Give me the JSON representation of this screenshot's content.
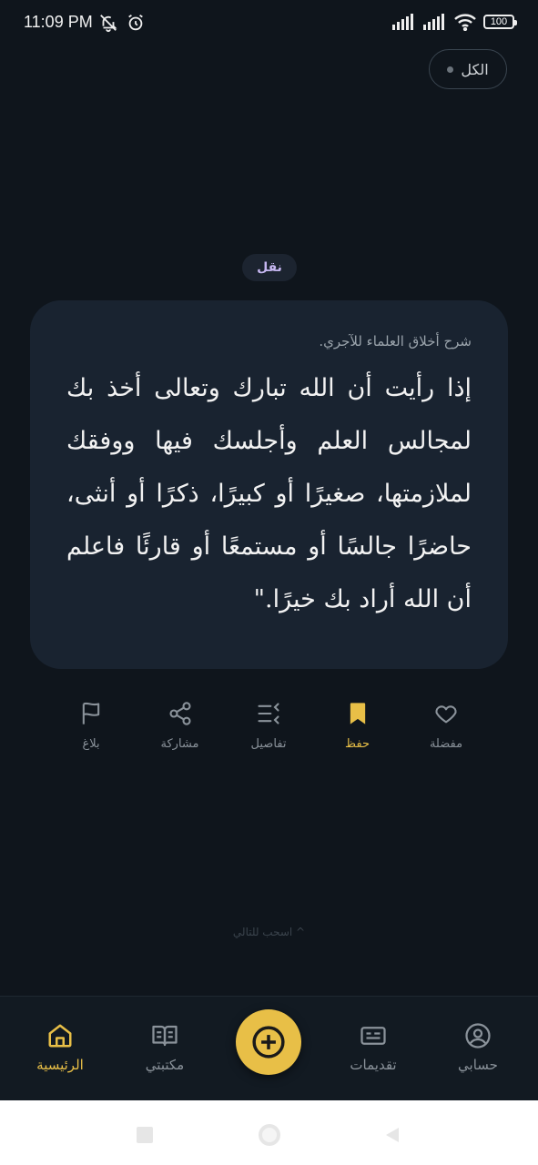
{
  "status": {
    "time": "11:09 PM",
    "battery": "100"
  },
  "filter": {
    "label": "الكل"
  },
  "tag": {
    "label": "نقل"
  },
  "quote": {
    "source": "شرح أخلاق العلماء للآجري.",
    "text": "إذا رأيت أن الله تبارك وتعالى أخذ بك لمجالس العلم وأجلسك فيها ووفقك لملازمتها، صغيرًا أو كبيرًا، ذكرًا أو أنثى، حاضرًا جالسًا أو مستمعًا أو قارئًا فاعلم أن الله أراد بك خيرًا.\""
  },
  "actions": [
    {
      "label": "مفضلة",
      "icon": "heart-icon"
    },
    {
      "label": "حفظ",
      "icon": "bookmark-icon",
      "active": true
    },
    {
      "label": "تفاصيل",
      "icon": "list-details-icon"
    },
    {
      "label": "مشاركة",
      "icon": "share-icon"
    },
    {
      "label": "بلاغ",
      "icon": "flag-icon"
    }
  ],
  "swipe_hint": "^ اسحب للتالي",
  "nav": {
    "account": "حسابي",
    "submissions": "تقديمات",
    "add": "plus-circle-icon",
    "library": "مكتبتي",
    "home": "الرئيسية"
  },
  "colors": {
    "accent": "#e8bf47",
    "card": "#192330",
    "background": "#0f151c"
  }
}
